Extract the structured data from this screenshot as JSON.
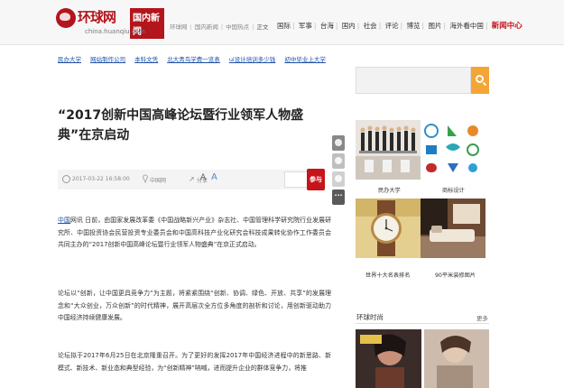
{
  "header": {
    "logo_text": "环球网",
    "logo_sub": "国内新闻",
    "logo_domain": "china.huanqiu.com",
    "breadcrumb": [
      "环球网",
      "国内新闻",
      "中国热点",
      "正文"
    ],
    "nav": [
      "国际",
      "军事",
      "台海",
      "国内",
      "社会",
      "评论",
      "博览",
      "图片",
      "海外看中国"
    ],
    "nav_highlight": "新闻中心"
  },
  "sublinks": [
    "民办大学",
    "网站制作公司",
    "本科文凭",
    "北大青鸟学费一览表",
    "ui设计培训多少钱",
    "初中毕业上大学"
  ],
  "article": {
    "title": "“2017创新中国高峰论坛暨行业领军人物盛典”在京启动",
    "time": "2017-03-22 16:58:00",
    "source": "中国网",
    "share": "分享",
    "font_small": "A",
    "font_large": "A",
    "ad_btn": "参与",
    "p1_kw": "中国",
    "p1_rest": "网讯 日前，由国家发展改革委《中国战略新兴产业》杂志社、中国管理科学研究院行业发展研究所、中国投资协会民营投资专业委员会和中国高科技产业化研究会科技成果转化协作工作委员会共同主办的“2017创新中国高峰论坛暨行业领军人物盛典”在京正式启动。",
    "p2": "论坛以“创新，让中国更具竞争力”为主题，将紧紧围绕“创新、协调、绿色、开放、共享”的发展理念和“大众创业，万众创新”的时代精神，展开高层次全方位多角度的剖析和讨论，用创新驱动助力中国经济持续健康发展。",
    "p3": "论坛拟于2017年6月25日在北京隆重召开。为了更好的发挥2017年中国经济进程中的新思路、新模式、新技术、新业态和典型经验，为“创新精神”呐喊，进而提升企业的群体竞争力，将推"
  },
  "sidebar": {
    "search_value": "",
    "thumbs": [
      {
        "caption": "民办大学",
        "icon": "classroom-photo"
      },
      {
        "caption": "商标设计",
        "icon": "logo-grid"
      },
      {
        "caption": "世界十大名表排名",
        "icon": "watch-photo"
      },
      {
        "caption": "90平米装修图片",
        "icon": "interior-photo"
      }
    ],
    "hot_title": "环球时尚",
    "hot_more": "更多"
  }
}
